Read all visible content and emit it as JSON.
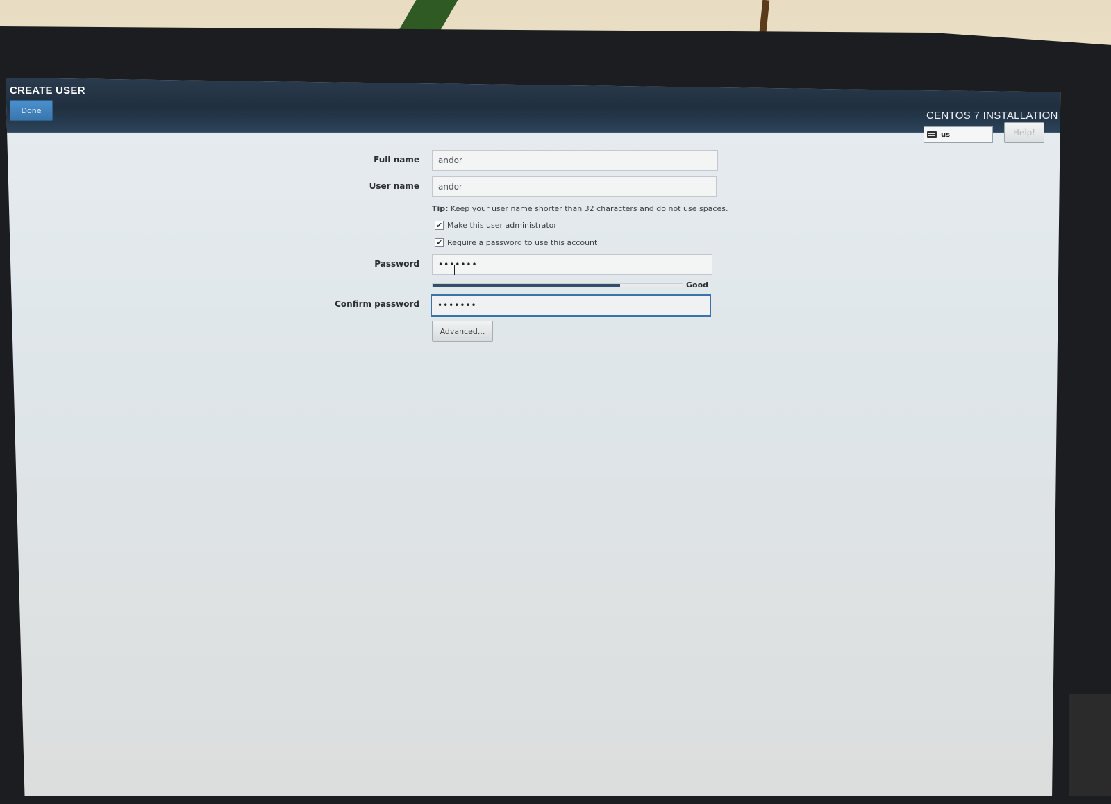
{
  "header": {
    "spoke_title": "CREATE USER",
    "done_label": "Done",
    "product_title": "CENTOS 7 INSTALLATION",
    "keyboard_layout": "us",
    "help_label": "Help!"
  },
  "form": {
    "full_name_label": "Full name",
    "full_name_value": "andor",
    "user_name_label": "User name",
    "user_name_value": "andor",
    "tip_prefix": "Tip:",
    "tip_text": "Keep your user name shorter than 32 characters and do not use spaces.",
    "admin_checkbox_label": "Make this user administrator",
    "admin_checked": true,
    "require_password_label": "Require a password to use this account",
    "require_password_checked": true,
    "password_label": "Password",
    "password_value": "•••••••",
    "password_strength_label": "Good",
    "password_strength_fraction": 0.75,
    "confirm_password_label": "Confirm password",
    "confirm_password_value": "•••••••",
    "advanced_label": "Advanced..."
  },
  "colors": {
    "header_bg": "#1f2f40",
    "done_button": "#3a76ae",
    "focus_border": "#3b73a8",
    "strength_fill": "#2f4f6b"
  }
}
